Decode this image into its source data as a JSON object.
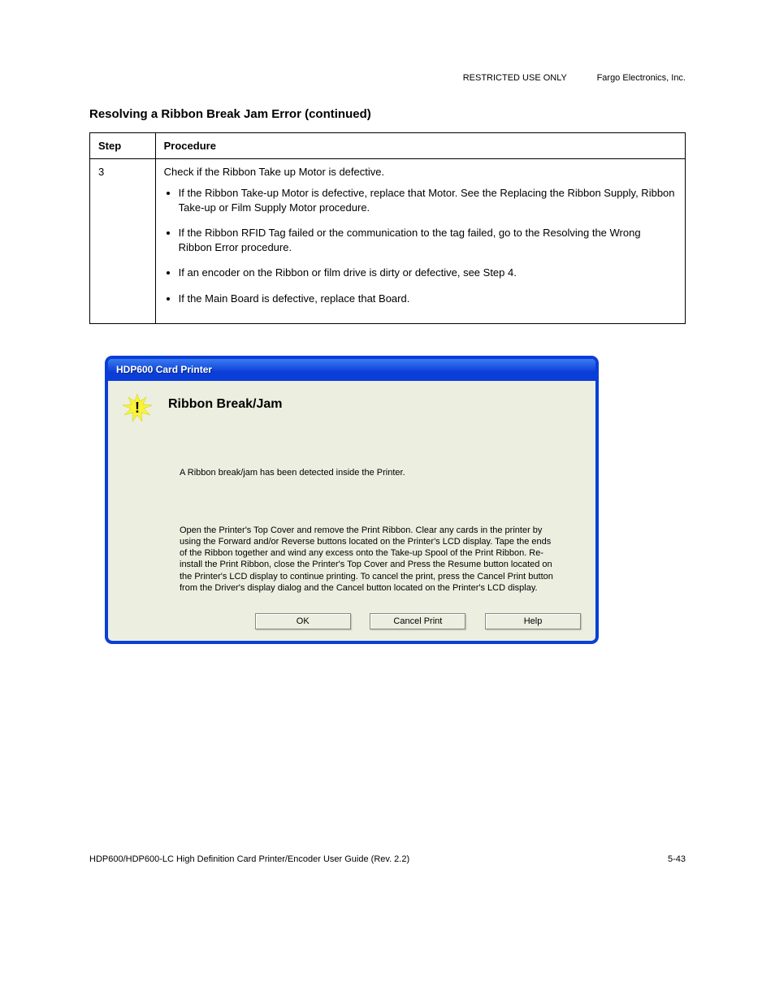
{
  "header_right": "RESTRICTED USE ONLY",
  "header_right2": "Fargo Electronics, Inc.",
  "section_title": "Resolving a Ribbon Break Jam Error (continued)",
  "table": {
    "headers": [
      "Step",
      "Procedure"
    ],
    "row_step": "3",
    "row_intro": "Check if the Ribbon Take up Motor is defective.",
    "bullets": [
      "If the Ribbon Take-up Motor is defective, replace that Motor. See the Replacing the Ribbon Supply, Ribbon Take-up or Film Supply Motor procedure.",
      "If the Ribbon RFID Tag failed or the communication to the tag failed, go to the Resolving the Wrong Ribbon Error procedure.",
      "If an encoder on the Ribbon or film drive is dirty or defective, see Step 4.",
      "If the Main Board is defective, replace that Board."
    ]
  },
  "dialog": {
    "title": "HDP600 Card Printer",
    "heading": "Ribbon Break/Jam",
    "summary": "A Ribbon break/jam has been detected inside the Printer.",
    "instructions": "Open the Printer's Top Cover and remove the Print Ribbon. Clear any cards in the printer by using the Forward and/or Reverse buttons located on the Printer's LCD display. Tape the ends of the Ribbon together and wind any excess onto the Take-up Spool of the Print Ribbon. Re-install the Print Ribbon, close the Printer's Top Cover and Press the Resume button located on the Printer's LCD display to continue printing. To cancel the print, press the Cancel Print button from the Driver's display dialog and the Cancel button located on the Printer's LCD display.",
    "buttons": {
      "ok": "OK",
      "cancel": "Cancel Print",
      "help": "Help"
    }
  },
  "footer_left": "HDP600/HDP600-LC High Definition Card Printer/Encoder User Guide (Rev. 2.2)",
  "footer_right": "5-43"
}
